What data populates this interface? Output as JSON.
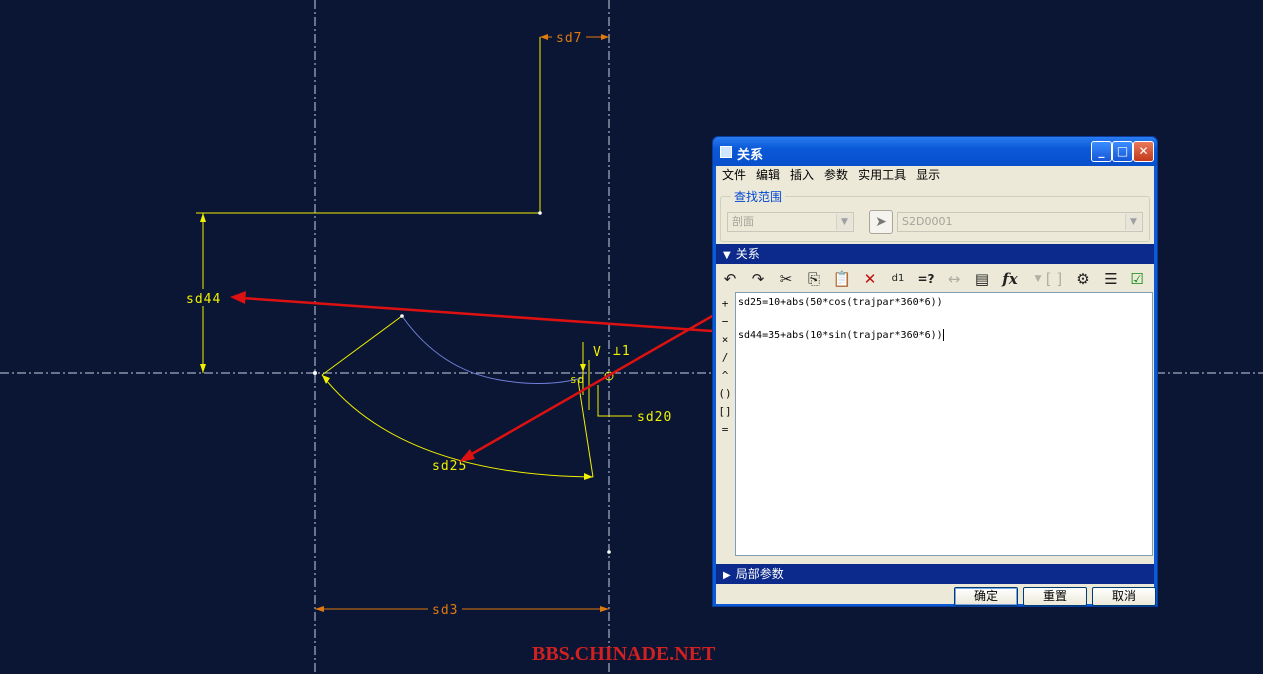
{
  "sketch": {
    "labels": {
      "sd7": "sd7",
      "sd44": "sd44",
      "sd20": "sd20",
      "sd25": "sd25",
      "sd3": "sd3",
      "v_marker": "V",
      "perp_marker": "⊥1",
      "sd_small": "sd"
    },
    "colors": {
      "background": "#0a1633",
      "geometry": "#f0f000",
      "dimension_orange": "#e07a10",
      "centerline": "#c8d0e0",
      "spline": "#6f7fd8",
      "arrow": "#dd1111"
    }
  },
  "dialog": {
    "title": "关系",
    "menu": [
      "文件",
      "编辑",
      "插入",
      "参数",
      "实用工具",
      "显示"
    ],
    "search_scope": {
      "legend": "查找范围",
      "type_value": "剖面",
      "object_value": "S2D0001"
    },
    "relations_header": "关系",
    "toolbar_icons": [
      "undo-icon",
      "redo-icon",
      "cut-icon",
      "copy-icon",
      "paste-icon",
      "delete-icon",
      "evaluate-icon",
      "verify-icon",
      "dimension-icon",
      "units-icon",
      "function-icon",
      "bracket-icon",
      "sort-icon",
      "insert-param-icon",
      "check-icon"
    ],
    "operators": [
      "+",
      "−",
      "×",
      "/",
      "^",
      "()",
      "[]",
      "="
    ],
    "relations": [
      "sd25=10+abs(50*cos(trajpar*360*6))",
      "sd44=35+abs(10*sin(trajpar*360*6))"
    ],
    "local_params_header": "局部参数",
    "buttons": {
      "ok": "确定",
      "reset": "重置",
      "cancel": "取消"
    }
  },
  "watermark": "BBS.CHINADE.NET"
}
